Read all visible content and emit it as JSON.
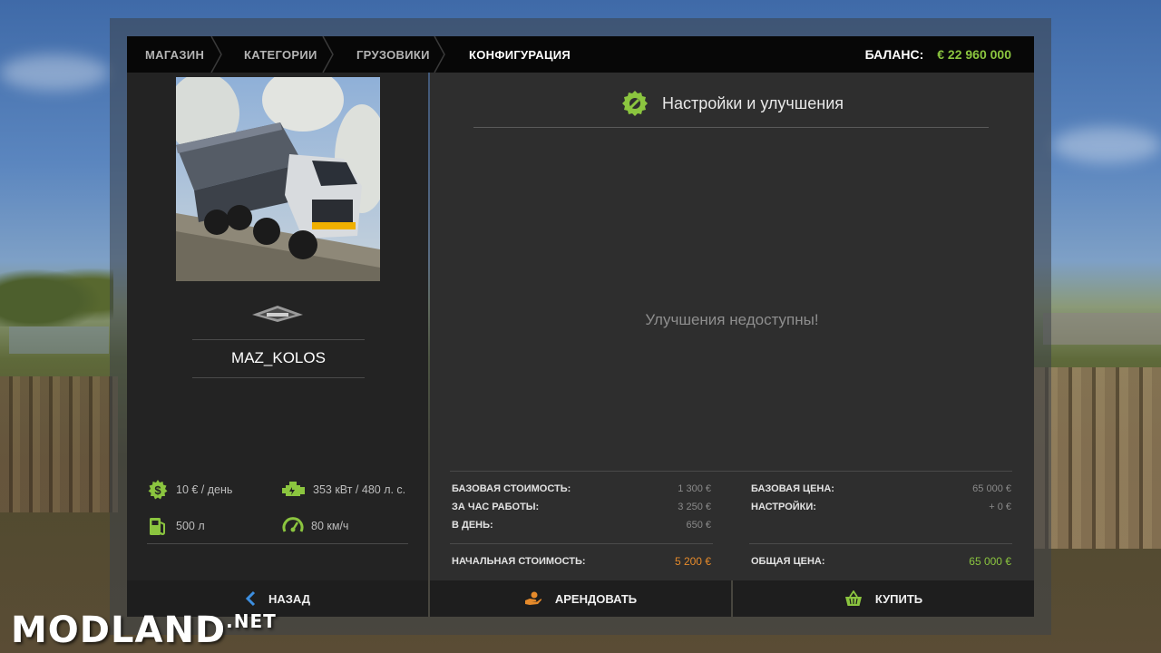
{
  "breadcrumb": [
    {
      "label": "МАГАЗИН",
      "active": false
    },
    {
      "label": "КАТЕГОРИИ",
      "active": false
    },
    {
      "label": "ГРУЗОВИКИ",
      "active": false
    },
    {
      "label": "КОНФИГУРАЦИЯ",
      "active": true
    }
  ],
  "balance": {
    "label": "БАЛАНС:",
    "value": "€ 22 960 000"
  },
  "vehicle": {
    "name": "MAZ_KOLOS",
    "brand_logo": "maz-brand-logo"
  },
  "attributes": {
    "cost_per_day": {
      "icon": "dollar-gear-icon",
      "text": "10 € / день"
    },
    "power": {
      "icon": "engine-icon",
      "text": "353 кВт / 480 л. с."
    },
    "fuel": {
      "icon": "fuel-pump-icon",
      "text": "500 л"
    },
    "speed": {
      "icon": "speedometer-icon",
      "text": "80 км/ч"
    }
  },
  "config_panel": {
    "title": "Настройки и улучшения",
    "icon": "wrench-gear-icon",
    "empty_message": "Улучшения недоступны!"
  },
  "lease_stats": {
    "base_cost": {
      "label": "БАЗОВАЯ СТОИМОСТЬ:",
      "value": "1 300 €"
    },
    "per_hour": {
      "label": "ЗА ЧАС РАБОТЫ:",
      "value": "3 250 €"
    },
    "per_day": {
      "label": "В ДЕНЬ:",
      "value": "650 €"
    },
    "initial_cost": {
      "label": "НАЧАЛЬНАЯ СТОИМОСТЬ:",
      "value": "5 200 €"
    }
  },
  "buy_stats": {
    "base_price": {
      "label": "БАЗОВАЯ ЦЕНА:",
      "value": "65 000 €"
    },
    "options": {
      "label": "НАСТРОЙКИ:",
      "value": "+ 0 €"
    },
    "total_price": {
      "label": "ОБЩАЯ ЦЕНА:",
      "value": "65 000 €"
    }
  },
  "buttons": {
    "back": "НАЗАД",
    "lease": "АРЕНДОВАТЬ",
    "buy": "КУПИТЬ"
  },
  "watermark": {
    "main": "MODLAND",
    "suffix": ".NET"
  },
  "colors": {
    "accent_green": "#8bc53f",
    "lease_orange": "#e58a2b",
    "back_blue": "#3d8fe0"
  }
}
